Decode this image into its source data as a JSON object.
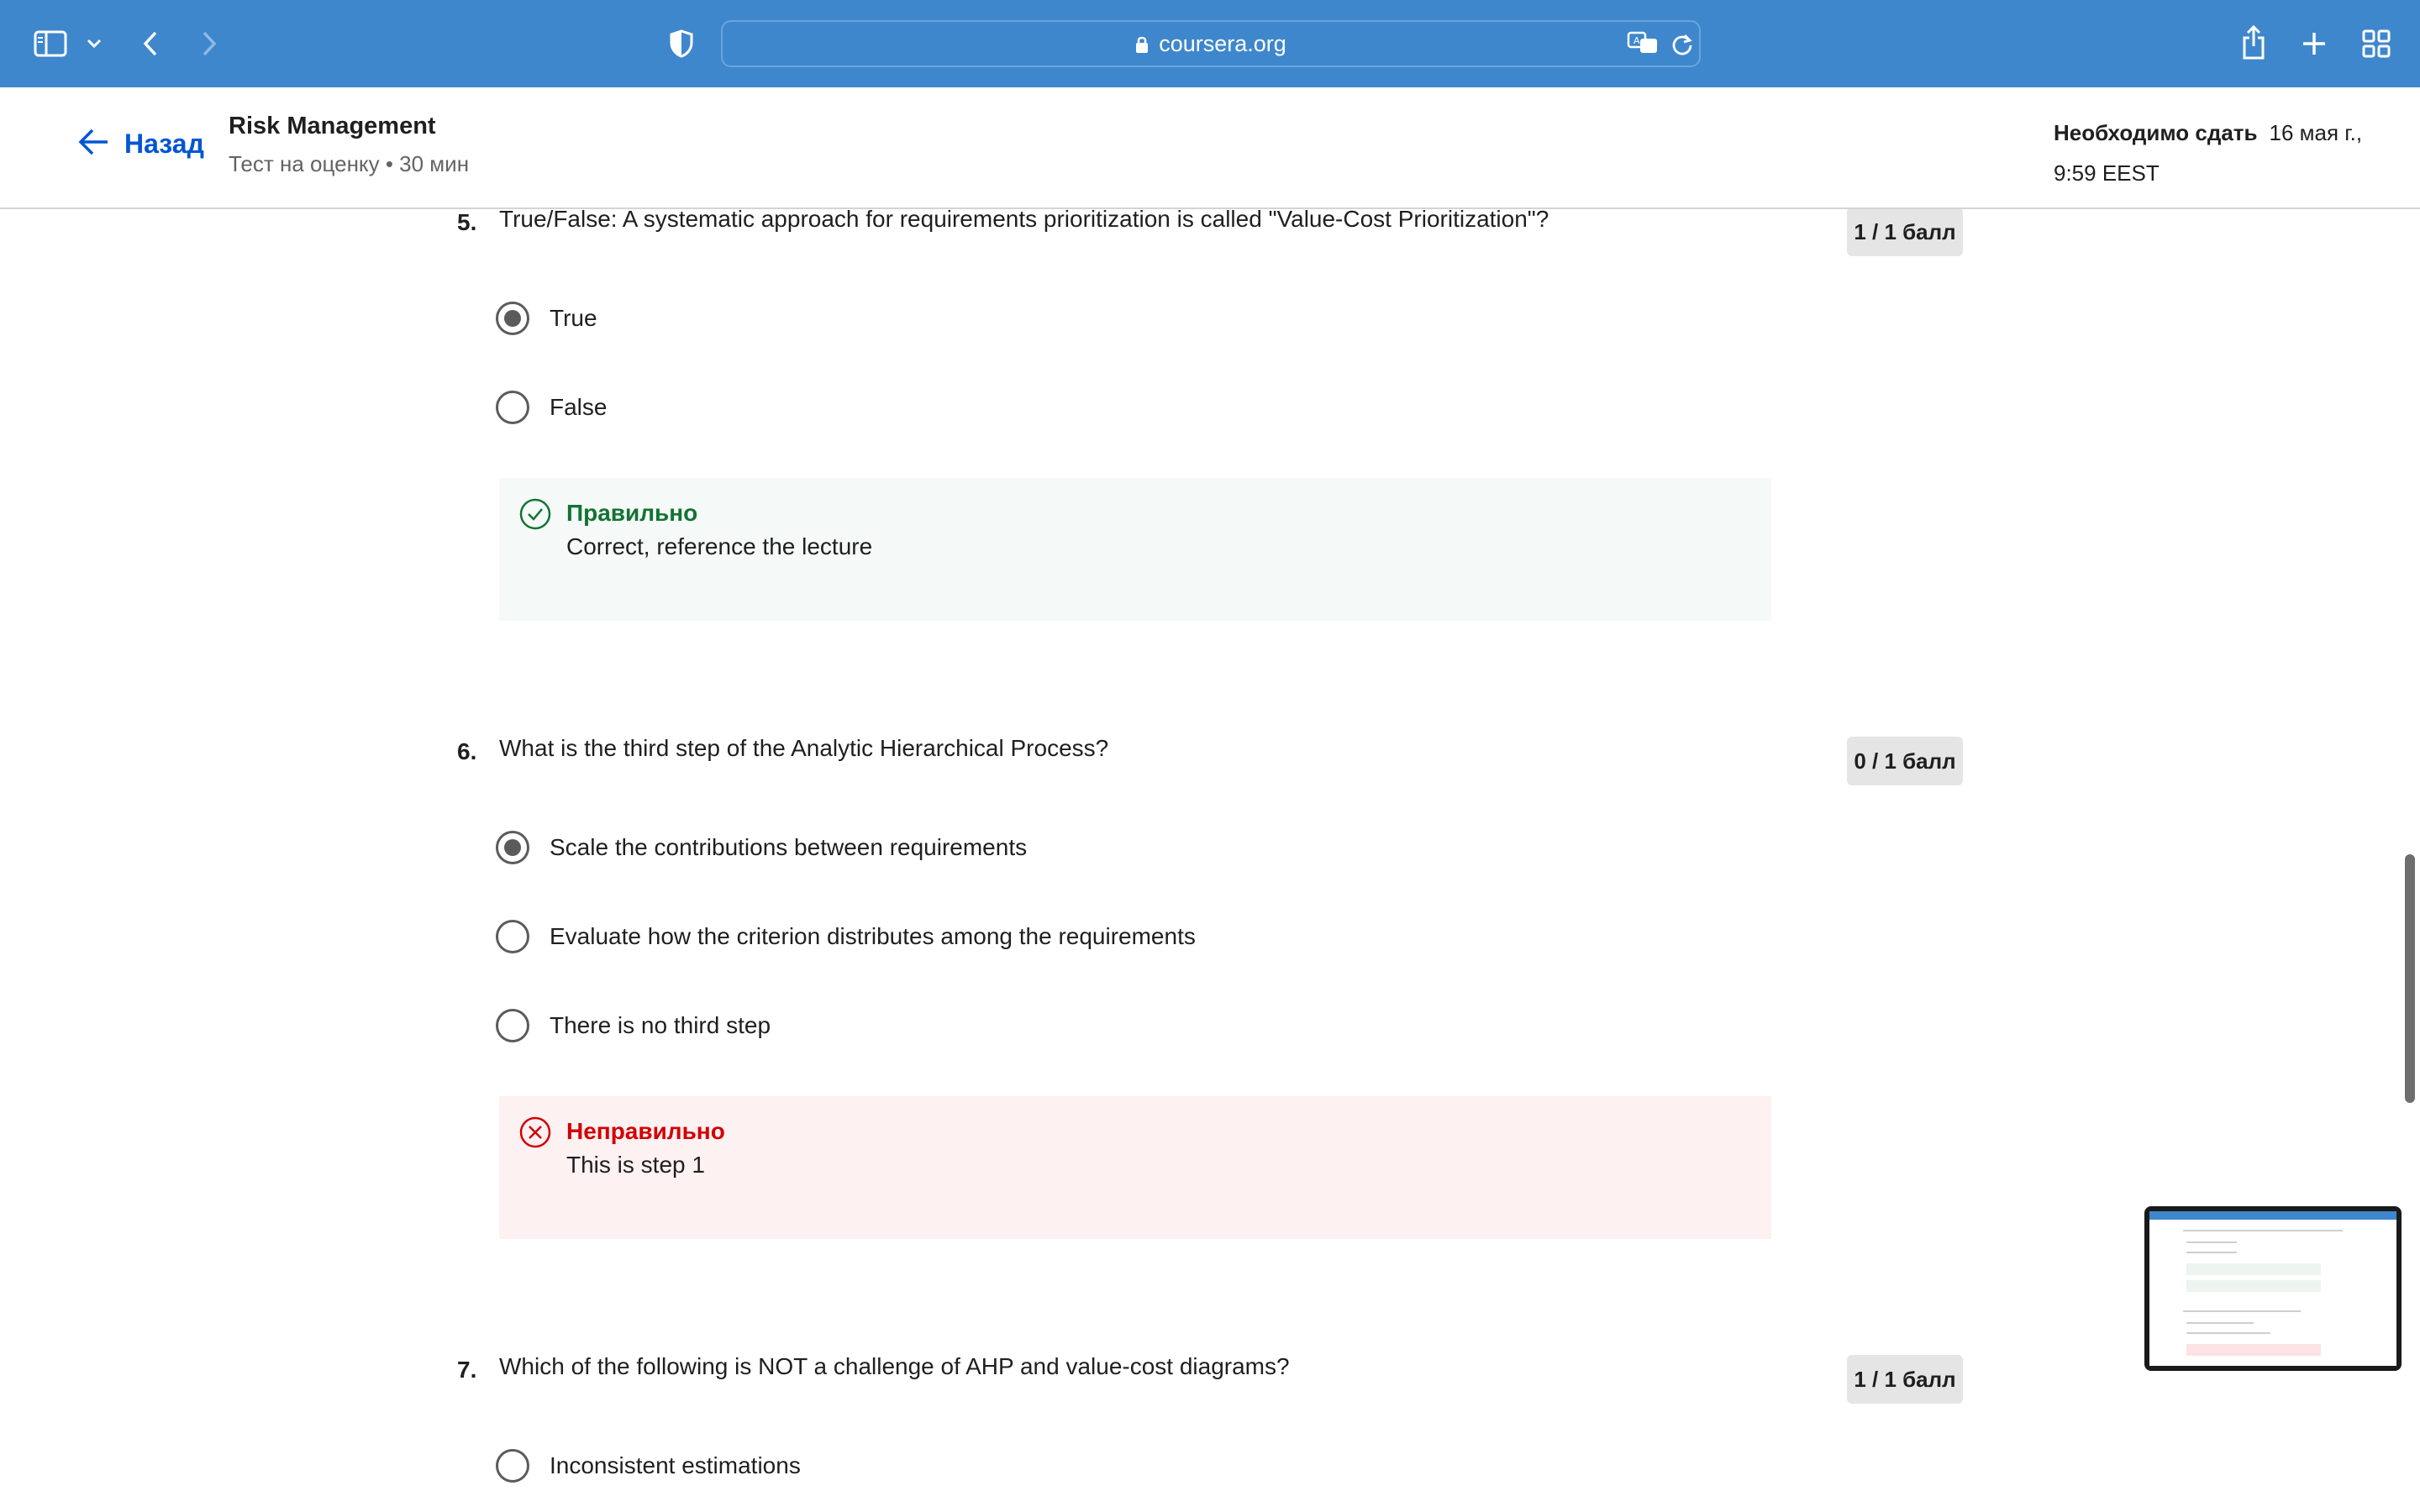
{
  "browser": {
    "url": "coursera.org",
    "icons": [
      "sidebar-toggle-icon",
      "chevron-down-icon",
      "back-arrow-icon",
      "forward-arrow-icon",
      "shield-icon",
      "lock-icon",
      "translate-icon",
      "reload-icon",
      "share-icon",
      "new-tab-icon",
      "tab-overview-icon"
    ]
  },
  "header": {
    "back_label": "Назад",
    "course_title": "Risk Management",
    "course_subtitle": "Тест на оценку • 30 мин",
    "due_label": "Необходимо сдать",
    "due_date": "16 мая г.,",
    "due_time": "9:59 EEST"
  },
  "questions": [
    {
      "number": "5.",
      "text": "True/False: A systematic approach for requirements prioritization is called \"Value-Cost Prioritization\"?",
      "score": "1 / 1 балл",
      "options": [
        {
          "label": "True",
          "selected": true
        },
        {
          "label": "False",
          "selected": false
        }
      ],
      "feedback": {
        "status": "correct",
        "title": "Правильно",
        "text": "Correct, reference the lecture"
      }
    },
    {
      "number": "6.",
      "text": "What is the third step of the Analytic Hierarchical Process?",
      "score": "0 / 1 балл",
      "options": [
        {
          "label": "Scale the contributions between requirements",
          "selected": true
        },
        {
          "label": "Evaluate how the criterion distributes among the requirements",
          "selected": false
        },
        {
          "label": "There is no third step",
          "selected": false
        }
      ],
      "feedback": {
        "status": "incorrect",
        "title": "Неправильно",
        "text": "This is step 1"
      }
    },
    {
      "number": "7.",
      "text": "Which of the following is NOT a challenge of AHP and value-cost diagrams?",
      "score": "1 / 1 балл",
      "options": [
        {
          "label": "Inconsistent estimations",
          "selected": false
        }
      ]
    }
  ],
  "colors": {
    "toolbar": "#3f87cc",
    "link": "#0056d2",
    "correct": "#137333",
    "incorrect": "#d30001",
    "correct_bg": "#f5f9f7",
    "incorrect_bg": "#fdf1f2"
  }
}
